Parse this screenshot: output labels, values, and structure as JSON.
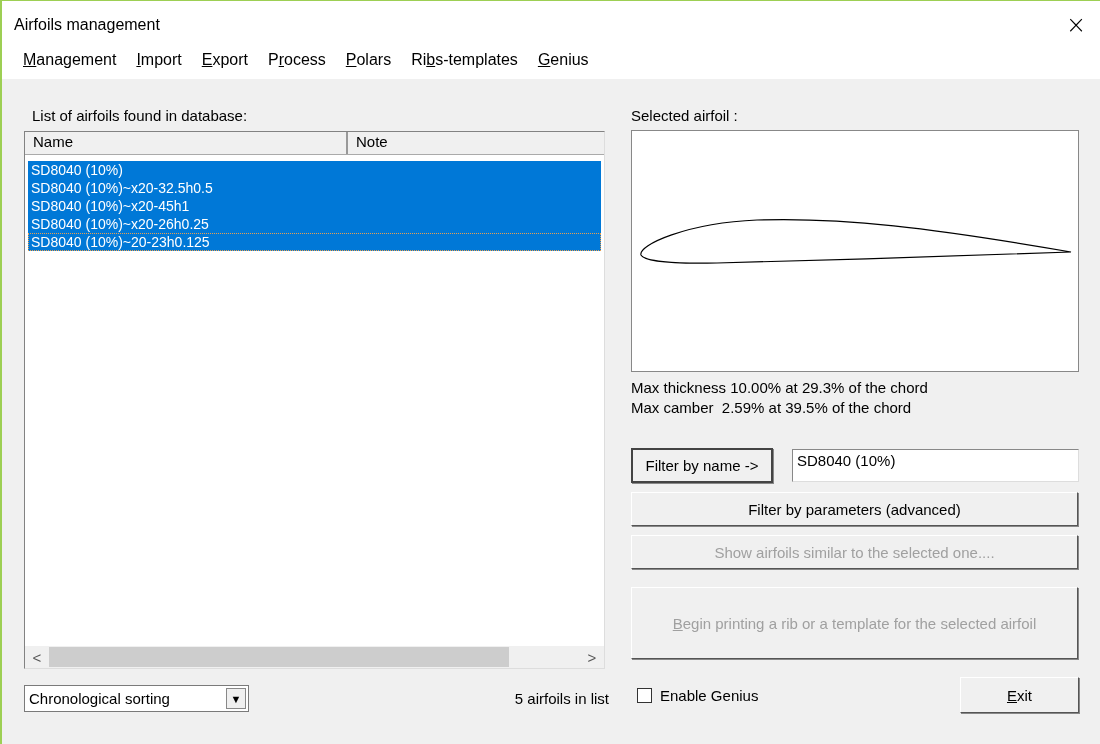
{
  "window": {
    "title": "Airfoils management",
    "close": "×"
  },
  "menu": [
    {
      "key": "M",
      "after": "anagement"
    },
    {
      "key": "I",
      "after": "mport"
    },
    {
      "key": "E",
      "after": "xport"
    },
    {
      "before": "P",
      "key": "r",
      "after": "ocess"
    },
    {
      "key": "P",
      "after": "olars"
    },
    {
      "before": "Ri",
      "key": "b",
      "after": "s-templates"
    },
    {
      "key": "G",
      "after": "enius"
    }
  ],
  "list": {
    "label": "List of airfoils found in database:",
    "columns": [
      "Name",
      "Note"
    ],
    "rows": [
      {
        "name": "SD8040 (10%)",
        "selected": true,
        "focused": false
      },
      {
        "name": "SD8040 (10%)~x20-32.5h0.5",
        "selected": true,
        "focused": false
      },
      {
        "name": "SD8040 (10%)~x20-45h1",
        "selected": true,
        "focused": false
      },
      {
        "name": "SD8040 (10%)~x20-26h0.25",
        "selected": true,
        "focused": false
      },
      {
        "name": "SD8040 (10%)~20-23h0.125",
        "selected": true,
        "focused": true
      }
    ],
    "scroll_left": "<",
    "scroll_right": ">"
  },
  "sorting": {
    "value": "Chronological sorting",
    "arrow": "▼"
  },
  "count": "5 airfoils in list",
  "preview": {
    "label": "Selected airfoil :",
    "stats": [
      "Max thickness 10.00% at 29.3% of the chord",
      "Max camber  2.59% at 39.5% of the chord"
    ]
  },
  "filter_name": {
    "button": "Filter by name ->",
    "value": "SD8040 (10%)"
  },
  "buttons": [
    {
      "after": "Filter by parameters (advanced)",
      "disabled": false
    },
    {
      "after": "Show airfoils similar to the selected one....",
      "disabled": true
    },
    {
      "key": "B",
      "after": "egin printing a rib or a template for the selected airfoil",
      "disabled": true
    }
  ],
  "genius": {
    "label": "Enable Genius",
    "checked": false
  },
  "exit": {
    "key": "E",
    "after": "xit",
    "disabled": false
  }
}
